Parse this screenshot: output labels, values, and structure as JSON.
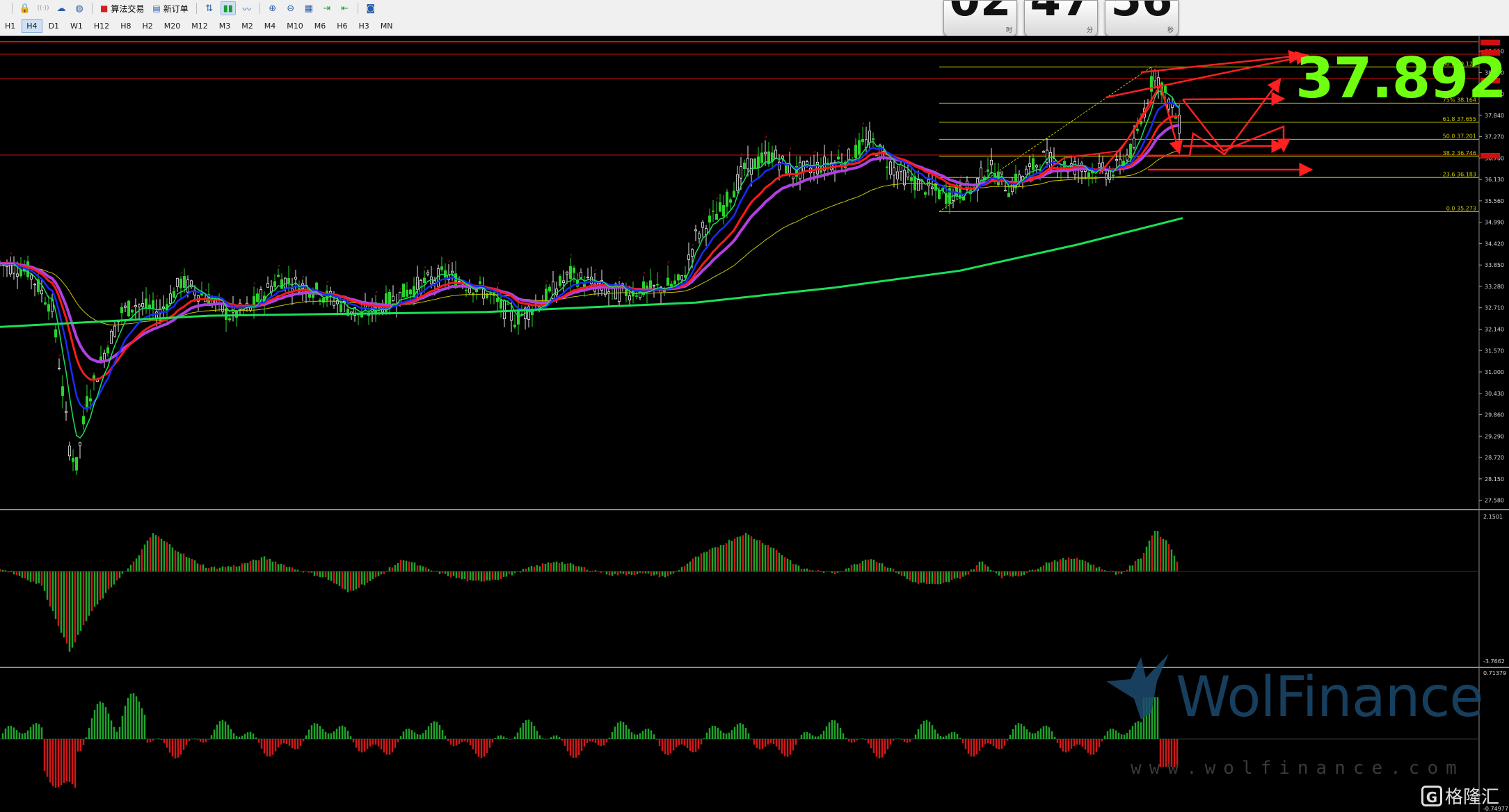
{
  "toolbar": {
    "items": [
      {
        "icon": "h1-label",
        "label": "H1"
      },
      {
        "icon": "lock-icon"
      },
      {
        "icon": "signal-icon"
      },
      {
        "icon": "cloud-icon"
      },
      {
        "icon": "globe-icon"
      },
      {
        "icon": "algo-trading-icon",
        "label": "算法交易"
      },
      {
        "icon": "new-order-icon",
        "label": "新订单"
      },
      {
        "icon": "trade-arrows-icon"
      },
      {
        "icon": "candlestick-icon"
      },
      {
        "icon": "line-chart-icon"
      },
      {
        "icon": "zoom-in-icon"
      },
      {
        "icon": "zoom-out-icon"
      },
      {
        "icon": "grid-icon"
      },
      {
        "icon": "autoscroll-icon"
      },
      {
        "icon": "chart-shift-icon"
      },
      {
        "icon": "screenshot-icon"
      }
    ]
  },
  "timeframes": [
    "H1",
    "H4",
    "D1",
    "W1",
    "H12",
    "H8",
    "H2",
    "M20",
    "M12",
    "M3",
    "M2",
    "M4",
    "M10",
    "M6",
    "H6",
    "H3",
    "MN"
  ],
  "active_timeframe": "H4",
  "countdown": [
    {
      "value": "02",
      "label": "时"
    },
    {
      "value": "47",
      "label": "分"
    },
    {
      "value": "56",
      "label": "秒"
    }
  ],
  "big_price": "37.892",
  "price_axis": [
    "39.550",
    "38.980",
    "38.410",
    "37.840",
    "37.270",
    "36.700",
    "36.130",
    "35.560",
    "34.990",
    "34.420",
    "33.850",
    "33.280",
    "32.710",
    "32.140",
    "31.570",
    "31.000",
    "30.430",
    "29.860",
    "29.290",
    "28.720",
    "28.150",
    "27.580"
  ],
  "fib_levels": [
    {
      "label": "100.0  39.129",
      "price": 39.129
    },
    {
      "label": "75%  38.164",
      "price": 38.164
    },
    {
      "label": "61.8  37.655",
      "price": 37.655
    },
    {
      "label": "50.0  37.201",
      "price": 37.201
    },
    {
      "label": "38.2  36.746",
      "price": 36.746
    },
    {
      "label": "23.6  36.183",
      "price": 36.183
    },
    {
      "label": "0.0  35.273",
      "price": 35.273
    }
  ],
  "indicator1_axis": {
    "top": "2.1501",
    "bottom": "-3.7662"
  },
  "indicator2_axis": {
    "top": "0.71379",
    "bottom": "-0.74977"
  },
  "watermark": {
    "brand": "WolFinance",
    "url": "www.wolfinance.com"
  },
  "corner_logo": "格隆汇",
  "colors": {
    "ma_green": "#19e05a",
    "ma_red": "#ff1a1a",
    "ma_blue": "#1a2cff",
    "ma_purple": "#b040e0",
    "ma_yellow": "#c8c800",
    "sma200": "#19e05a",
    "hist_up": "#1fa32a",
    "hist_down": "#d01818",
    "annotation": "#ff2020",
    "price_text": "#6fff10",
    "fib_line": "#c8c800"
  }
}
